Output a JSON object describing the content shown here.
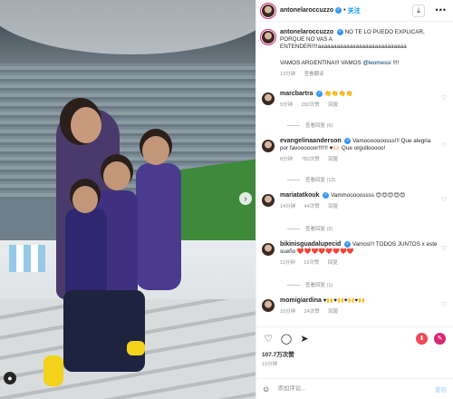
{
  "header": {
    "username": "antonelaroccuzzo",
    "dot": "•",
    "follow_label": "关注"
  },
  "caption": {
    "username": "antonelaroccuzzo",
    "text": "NO TE LO PUEDO EXPLICAR, PORQUE NO VAS A ENTENDER!!!!aaaaaaaaaaaaaaaaaaaaaaaaaaaa",
    "text2_prefix": "VAMOS ARGENTINA!!! VAMOS ",
    "mention": "@leomessi",
    "text2_suffix": " !!!!",
    "time": "13分钟",
    "translate": "查看翻译"
  },
  "comments": [
    {
      "username": "marcbartra",
      "text": "👏👏👏👏",
      "time": "5分钟",
      "likes": "292次赞",
      "reply": "回复",
      "view_replies": "查看回复 (6)"
    },
    {
      "username": "evangelinaanderson",
      "text": "Vamooooooosss!!! Que alegria por favoooooor!!!!!! ♥🙌🏻 Que orgullooooo!",
      "time": "8分钟",
      "likes": "782次赞",
      "reply": "回复",
      "view_replies": "查看回复 (13)"
    },
    {
      "username": "mariatatkouk",
      "text": "Vammooooossss 😍😍😍😍😍",
      "time": "14分钟",
      "likes": "44次赞",
      "reply": "回复",
      "view_replies": "查看回复 (2)"
    },
    {
      "username": "bikinisguadalupecid",
      "text": "Vamos!!! TODOS JUNTOS x este sueño ❤️❤️❤️❤️❤️❤️❤️❤️",
      "time": "11分钟",
      "likes": "19次赞",
      "reply": "回复",
      "view_replies": "查看回复 (1)"
    },
    {
      "username": "momigiardina",
      "text": "♥🙌♥🙌♥🙌♥🙌",
      "time": "10分钟",
      "likes": "24次赞",
      "reply": "回复",
      "view_replies": ""
    }
  ],
  "footer": {
    "likes": "107.7万次赞",
    "time": "19分钟",
    "comment_placeholder": "添加评论...",
    "post_label": "发布"
  },
  "colors": {
    "accent": "#0095f6",
    "verified": "#3897f0",
    "red_btn": "#ed4956",
    "pink_btn": "#d62976"
  },
  "icons": [
    "heart-icon",
    "comment-icon",
    "share-icon",
    "save-icon",
    "more-icon",
    "next-icon",
    "user-tag-icon",
    "emoji-icon"
  ]
}
